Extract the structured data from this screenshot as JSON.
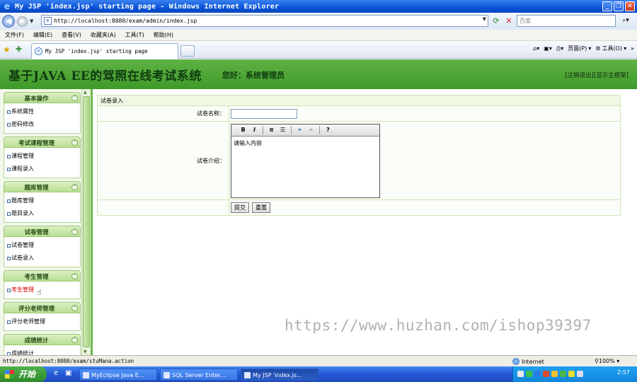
{
  "window": {
    "title": "My JSP 'index.jsp' starting page - Windows Internet Explorer"
  },
  "address": {
    "url": "http://localhost:8080/exam/admin/index.jsp",
    "search_placeholder": "百度"
  },
  "menu": [
    "文件(F)",
    "编辑(E)",
    "查看(V)",
    "收藏夹(A)",
    "工具(T)",
    "帮助(H)"
  ],
  "tab": {
    "title": "My JSP 'index.jsp' starting page"
  },
  "commandbar": {
    "page": "页面(P)",
    "tools": "工具(O)"
  },
  "header": {
    "site_title": "基于JAVA EE的驾照在线考试系统",
    "greeting": "您好：系统管理员",
    "links": "[注销退出][显示主框架]"
  },
  "sidebar": {
    "sections": [
      {
        "title": "基本操作",
        "items": [
          "系统属性",
          "密码修改"
        ]
      },
      {
        "title": "考试课程管理",
        "items": [
          "课程管理",
          "课程录入"
        ]
      },
      {
        "title": "题库管理",
        "items": [
          "题库管理",
          "题目录入"
        ]
      },
      {
        "title": "试卷管理",
        "items": [
          "试卷管理",
          "试卷录入"
        ]
      },
      {
        "title": "考生管理",
        "items": [
          "考生管理"
        ]
      },
      {
        "title": "评分老师管理",
        "items": [
          "评分老师管理"
        ]
      },
      {
        "title": "成绩统计",
        "items": [
          "成绩统计"
        ]
      }
    ]
  },
  "form": {
    "panel_title": "试卷录入",
    "name_label": "试卷名称：",
    "name_value": "",
    "intro_label": "试卷介绍：",
    "editor_text": "请输入内容",
    "submit": "提交",
    "reset": "重置"
  },
  "watermark": "https://www.huzhan.com/ishop39397",
  "statusbar": {
    "url": "http://localhost:8080/exam/stuMana.action",
    "zone": "Internet",
    "zoom": "100%"
  },
  "taskbar": {
    "start": "开始",
    "tasks": [
      "MyEclipse Java E...",
      "SQL Server Enter...",
      "My JSP 'index.js..."
    ],
    "clock": "2:57"
  },
  "colors": {
    "header_green": "#4fa836",
    "sidebar_head": "#c8e6a6",
    "active_item": "#d80000"
  }
}
